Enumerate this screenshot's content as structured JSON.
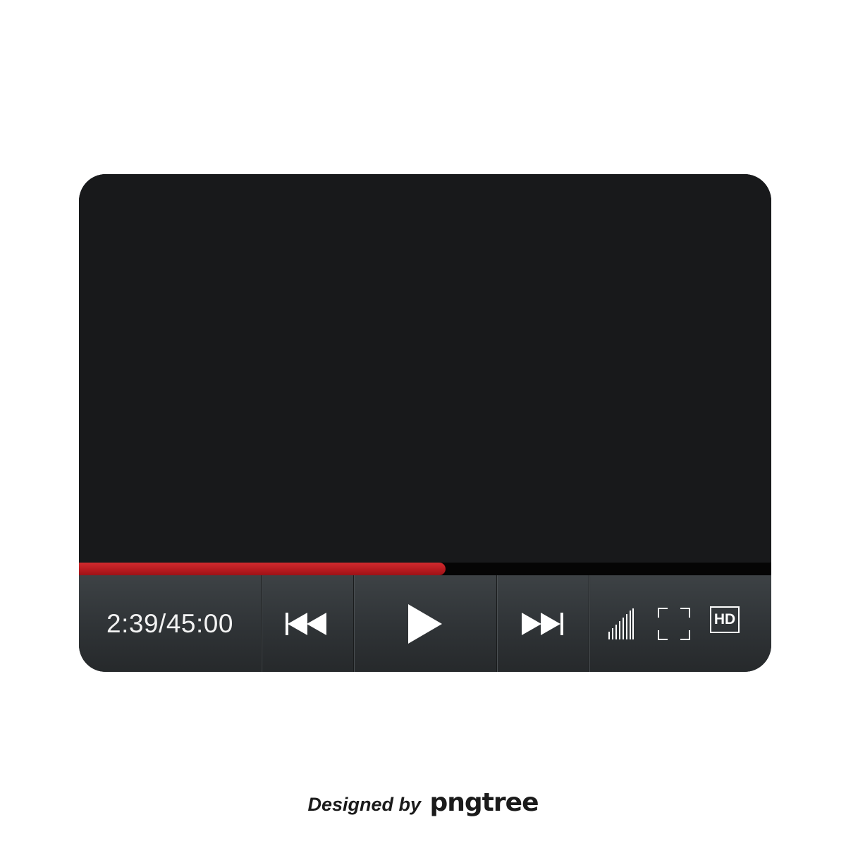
{
  "player": {
    "time_display": "2:39/45:00",
    "progress_fraction": 0.53,
    "hd_label": "HD",
    "controls": {
      "previous_icon": "skip-previous-icon",
      "play_icon": "play-icon",
      "next_icon": "skip-next-icon",
      "volume_icon": "volume-bars-icon",
      "fullscreen_icon": "fullscreen-icon"
    }
  },
  "colors": {
    "accent": "#c0161c",
    "screen": "#18191b",
    "control_bar": "#34383b",
    "icon": "#ffffff"
  },
  "credit": {
    "designed_by": "Designed by",
    "brand": "pngtree"
  }
}
